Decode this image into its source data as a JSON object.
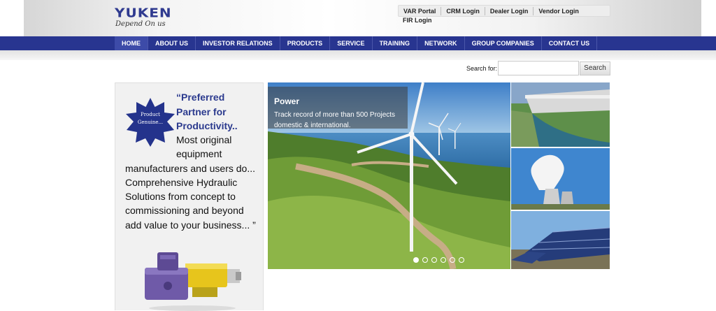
{
  "brand": {
    "name": "YUKEN",
    "tagline": "Depend On us",
    "color": "#2f3a8f"
  },
  "logins": [
    "VAR Portal",
    "CRM Login",
    "Dealer Login",
    "Vendor Login"
  ],
  "fir_login": "FIR Login",
  "nav": {
    "color": "#283590",
    "items": [
      "HOME",
      "ABOUT US",
      "INVESTOR RELATIONS",
      "PRODUCTS",
      "SERVICE",
      "TRAINING",
      "NETWORK",
      "GROUP COMPANIES",
      "CONTACT US"
    ],
    "active": "HOME"
  },
  "search": {
    "label": "Search for:",
    "value": "",
    "button": "Search"
  },
  "promo": {
    "badge_line1": "Product",
    "badge_line2": "Genuine...",
    "heading_line1": "“Preferred",
    "heading_line2": "Partner for",
    "heading_line3": "Productivity..",
    "body_indent": "Most original",
    "body_line2": "equipment",
    "body_rest": "manufacturers and users do... Comprehensive Hydraulic Solutions from concept to commissioning and beyond add value to your business... ”"
  },
  "slider": {
    "title": "Power",
    "text": "Track record of more than 500 Projects domestic & international.",
    "dot_count": 6,
    "active_dot": 1
  },
  "thumbnails": [
    "dam-thumbnail",
    "cooling-tower-thumbnail",
    "solar-panel-thumbnail"
  ]
}
